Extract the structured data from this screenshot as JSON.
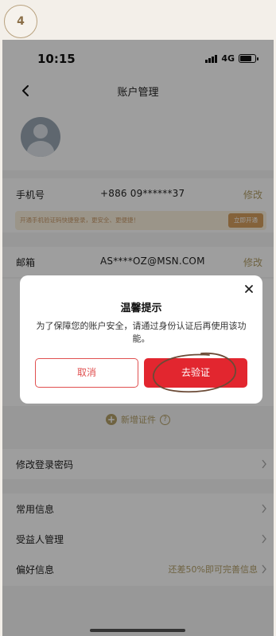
{
  "step": {
    "number": "4"
  },
  "status_bar": {
    "time": "10:15",
    "network": "4G",
    "battery_level": 0.75
  },
  "nav": {
    "title": "账户管理"
  },
  "rows": {
    "phone": {
      "label": "手机号",
      "value": "+886 09******37",
      "action": "修改"
    },
    "email": {
      "label": "邮箱",
      "value": "AS****OZ@MSN.COM",
      "action": "修改"
    },
    "password": {
      "label": "修改登录密码"
    },
    "common_info": {
      "label": "常用信息"
    },
    "beneficiary": {
      "label": "受益人管理"
    },
    "preferences": {
      "label": "偏好信息",
      "extra": "还差50%即可完善信息"
    }
  },
  "promo": {
    "text": "开通手机验证码快捷登录，更安全、更便捷！",
    "button": "立即开通"
  },
  "add_id": {
    "label": "新增证件",
    "help": "?"
  },
  "dialog": {
    "title": "温馨提示",
    "message": "为了保障您的账户安全，请通过身份认证后再使用该功能。",
    "cancel": "取消",
    "confirm": "去验证"
  },
  "colors": {
    "accent_gold": "#b3a06a",
    "primary_red": "#e2262f"
  }
}
